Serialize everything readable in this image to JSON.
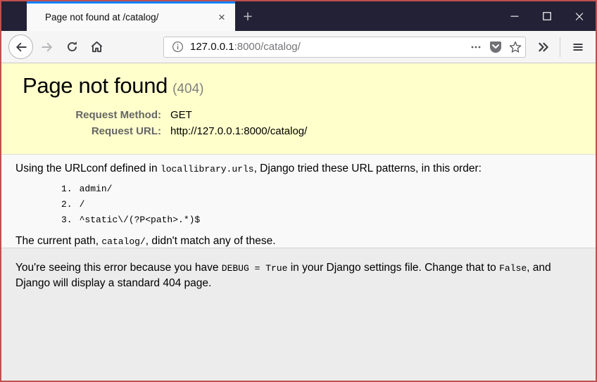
{
  "colors": {
    "window_border": "#c0504e",
    "titlebar_bg": "#232135",
    "active_tab_stripe": "#0a84ff",
    "summary_bg": "#ffffcc",
    "explanation_bg": "#ececec"
  },
  "icons": {
    "tab_close": "×",
    "new_tab": "+",
    "window_minimize": "minimize-bar",
    "window_maximize": "maximize-square",
    "window_close": "×",
    "back": "left-arrow",
    "forward": "right-arrow",
    "reload": "circular-arrow",
    "home": "house",
    "site_info": "info-circle",
    "page_actions": "three-dots",
    "pocket": "pocket-chevron-badge",
    "bookmark": "star-outline",
    "overflow": "double-chevron-right",
    "menu": "hamburger"
  },
  "tab_bar": {
    "tab_title": "Page not found at /catalog/"
  },
  "toolbar": {
    "url_host": "127.0.0.1",
    "url_rest": ":8000/catalog/"
  },
  "page": {
    "summary": {
      "title": "Page not found",
      "status": "(404)",
      "rows": [
        {
          "label": "Request Method:",
          "value": "GET"
        },
        {
          "label": "Request URL:",
          "value": "http://127.0.0.1:8000/catalog/"
        }
      ]
    },
    "info": {
      "intro_before": "Using the URLconf defined in ",
      "intro_code": "locallibrary.urls",
      "intro_after": ", Django tried these URL patterns, in this order:",
      "patterns": [
        {
          "num": "1.",
          "pattern": "admin/"
        },
        {
          "num": "2.",
          "pattern": "/"
        },
        {
          "num": "3.",
          "pattern": "^static\\/(?P<path>.*)$"
        }
      ],
      "current_before": "The current path, ",
      "current_code": "catalog/",
      "current_after": ", didn't match any of these."
    },
    "explanation": {
      "part1": "You're seeing this error because you have ",
      "code1": "DEBUG = True",
      "part2": " in your Django settings file. Change that to ",
      "code2": "False",
      "part3": ", and Django will display a standard 404 page."
    }
  }
}
